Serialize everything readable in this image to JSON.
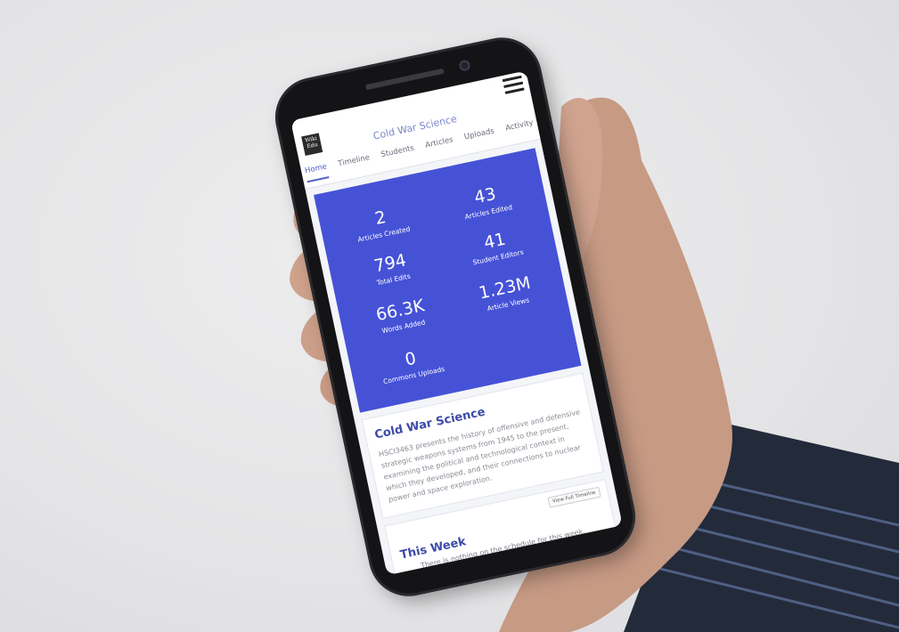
{
  "header": {
    "logo_text": "Wiki Edu",
    "course_title": "Cold War Science"
  },
  "tabs": [
    {
      "label": "Home",
      "active": true
    },
    {
      "label": "Timeline",
      "active": false
    },
    {
      "label": "Students",
      "active": false
    },
    {
      "label": "Articles",
      "active": false
    },
    {
      "label": "Uploads",
      "active": false
    },
    {
      "label": "Activity",
      "active": false
    }
  ],
  "stats": {
    "color": "#4652d6",
    "items": [
      {
        "value": "2",
        "label": "Articles Created"
      },
      {
        "value": "43",
        "label": "Articles Edited"
      },
      {
        "value": "794",
        "label": "Total Edits"
      },
      {
        "value": "41",
        "label": "Student Editors"
      },
      {
        "value": "66.3K",
        "label": "Words Added"
      },
      {
        "value": "1.23M",
        "label": "Article Views"
      },
      {
        "value": "0",
        "label": "Commons Uploads"
      }
    ]
  },
  "description": {
    "title": "Cold War Science",
    "text": "HSCI3463 presents the history of offensive and defensive strategic weapons systems from 1945 to the present, examining the political and technological context in which they developed, and their connections to nuclear power and space exploration."
  },
  "this_week": {
    "title": "This Week",
    "button_label": "View Full Timeline",
    "empty_text": "There is nothing on the schedule for this week."
  }
}
